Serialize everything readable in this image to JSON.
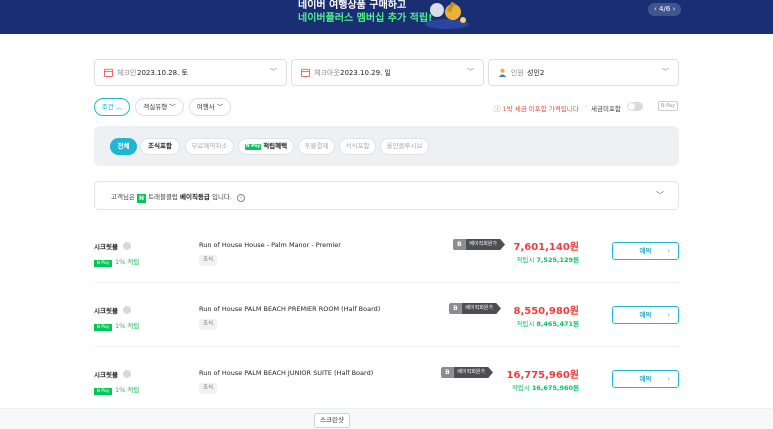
{
  "banner": {
    "line1": "네이버 여행상품 구매하고",
    "line2": "네이버플러스 멤버십 추가 적립!",
    "pager": "‹ 4/6 ›"
  },
  "search": {
    "checkin": {
      "label": "체크인",
      "value": "2023.10.28. 토"
    },
    "checkout": {
      "label": "체크아웃",
      "value": "2023.10.29. 일"
    },
    "guests": {
      "label": "인원",
      "value": "성인2"
    }
  },
  "pills": {
    "conditions": "조건 ︿",
    "room_type": "객실유형 ﹀",
    "travel_agency": "여행사 ﹀"
  },
  "tax": {
    "note": "ⓘ 1박 세금 미포함 가격입니다",
    "separator": "·",
    "toggle_label": "세금미포함",
    "pay_logo": "N Pay"
  },
  "filter_chips": [
    {
      "label": "전체",
      "active": true
    },
    {
      "label": "조식포함",
      "bold": true
    },
    {
      "label": "무료예약취소"
    },
    {
      "label": "적립혜택",
      "badge": "N Pay",
      "bold": true
    },
    {
      "label": "후불결제"
    },
    {
      "label": "석식포함"
    },
    {
      "label": "올인클루시브"
    }
  ],
  "membership": {
    "prefix": "고객님은",
    "badge": "N",
    "program": "트래블클럽",
    "level": "베이직등급",
    "suffix": "입니다.",
    "info_icon": "i"
  },
  "rooms": [
    {
      "provider": "시크릿몰",
      "pay_badge": "N Pay",
      "earn_rate": "1% 적립",
      "title": "Run of House House - Palm Manor - Premier",
      "meal": "조식",
      "grade_letter": "B",
      "grade_text": "베이직회원가",
      "price": "7,601,140원",
      "earn_label": "적립시",
      "earn_price": "7,525,129원",
      "button": "예약"
    },
    {
      "provider": "시크릿몰",
      "pay_badge": "N Pay",
      "earn_rate": "1% 적립",
      "title": "Run of House PALM BEACH PREMIER ROOM (Half Board)",
      "meal": "조식",
      "grade_letter": "B",
      "grade_text": "베이직회원가",
      "price": "8,550,980원",
      "earn_label": "적립시",
      "earn_price": "8,465,471원",
      "button": "예약"
    },
    {
      "provider": "시크릿몰",
      "pay_badge": "N Pay",
      "earn_rate": "1% 적립",
      "title": "Run of House PALM BEACH JUNIOR SUITE (Half Board)",
      "meal": "조식",
      "grade_letter": "B",
      "grade_text": "베이직회원가",
      "price": "16,775,960원",
      "earn_label": "적립시",
      "earn_price": "16,675,960원",
      "button": "예약"
    }
  ],
  "screenshot_tip": "스크린샷",
  "colors": {
    "accent": "#1fb6d5",
    "naver_green": "#03c75a",
    "price_red": "#f03c3c",
    "banner_bg": "#1a2f73"
  }
}
